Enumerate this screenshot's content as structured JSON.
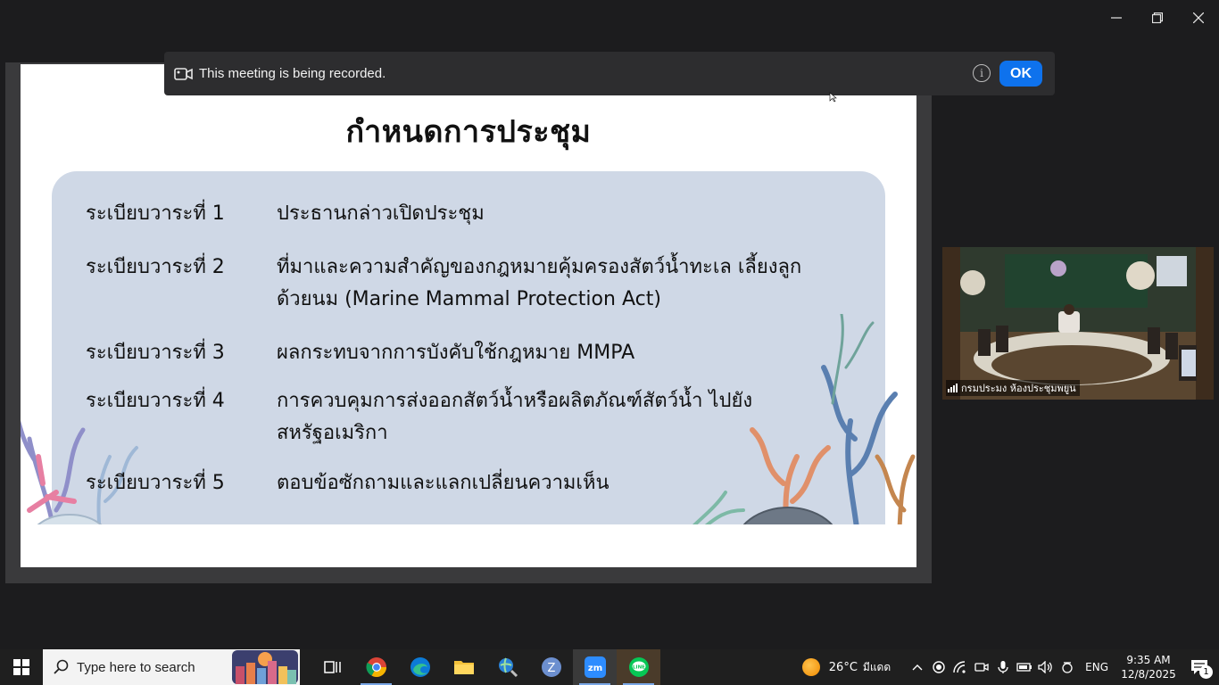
{
  "banner": {
    "message": "This meeting is being recorded.",
    "ok_label": "OK",
    "info_glyph": "i"
  },
  "slide": {
    "title": "กำหนดการประชุม",
    "agenda": [
      {
        "num": "ระเบียบวาระที่ 1",
        "text": "ประธานกล่าวเปิดประชุม"
      },
      {
        "num": "ระเบียบวาระที่ 2",
        "text": "ที่มาและความสำคัญของกฎหมายคุ้มครองสัตว์น้ำทะเล เลี้ยงลูกด้วยนม (Marine Mammal Protection Act)"
      },
      {
        "num": "ระเบียบวาระที่ 3",
        "text": "ผลกระทบจากการบังคับใช้กฎหมาย MMPA"
      },
      {
        "num": "ระเบียบวาระที่ 4",
        "text": "การควบคุมการส่งออกสัตว์น้ำหรือผลิตภัณฑ์สัตว์น้ำ ไปยังสหรัฐอเมริกา"
      },
      {
        "num": "ระเบียบวาระที่ 5",
        "text": "ตอบข้อซักถามและแลกเปลี่ยนความเห็น"
      }
    ]
  },
  "video": {
    "participant_label": "กรมประมง ห้องประชุมพยูน"
  },
  "taskbar": {
    "search_placeholder": "Type here to search",
    "apps": [
      "task-view",
      "chrome",
      "edge",
      "file-explorer",
      "magnifier-app",
      "zoom-settings",
      "zoom",
      "line"
    ],
    "weather_temp": "26°C",
    "weather_desc": "มีแดด",
    "language": "ENG",
    "time": "9:35 AM",
    "date": "12/8/2025",
    "notification_count": "1"
  },
  "colors": {
    "ok_button": "#0e72ed",
    "agenda_panel": "#cfd8e6",
    "taskbar": "#1f1f1f"
  }
}
